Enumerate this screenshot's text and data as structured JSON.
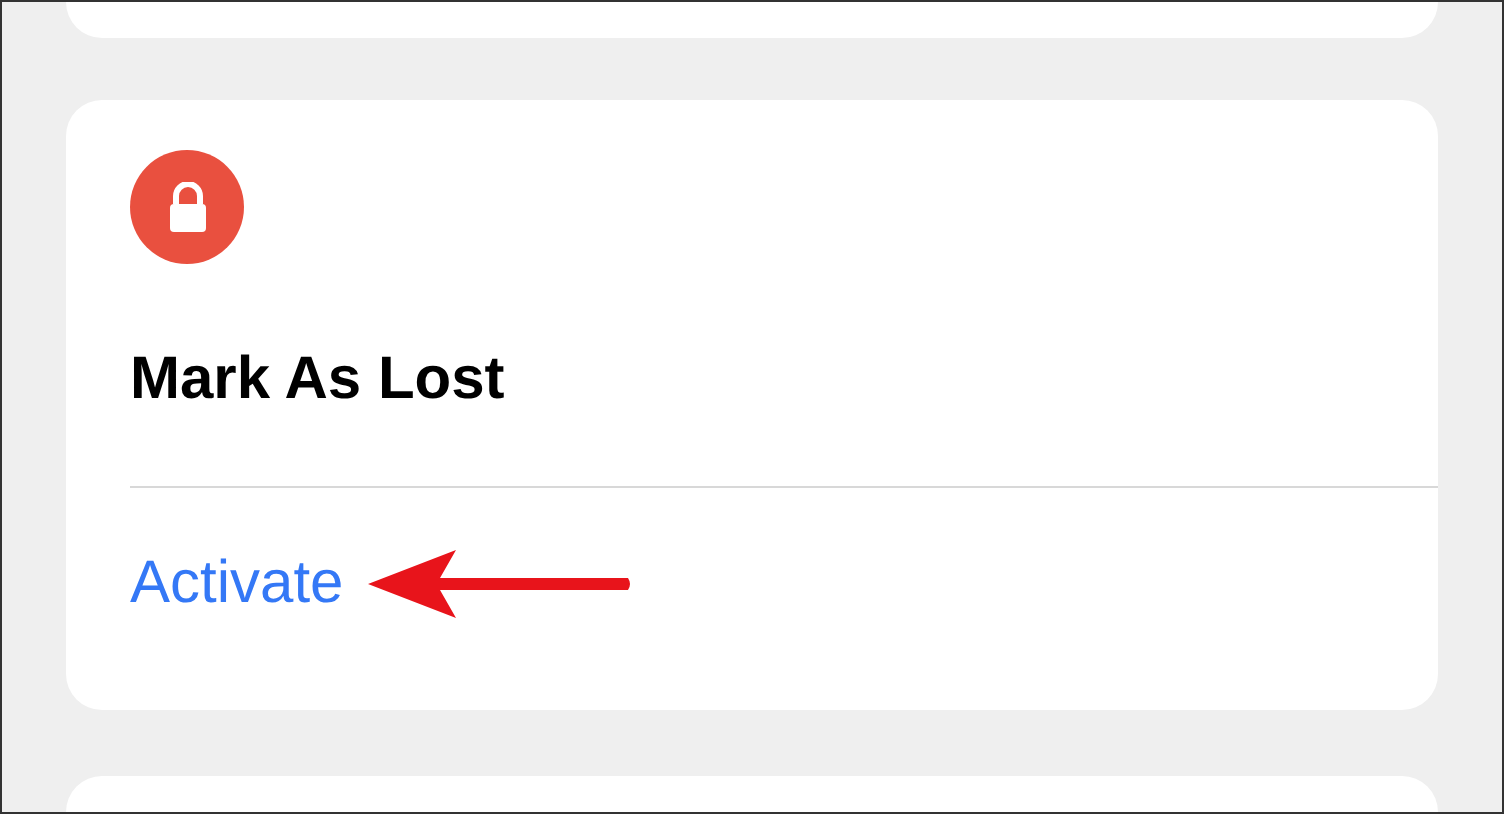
{
  "card": {
    "title": "Mark As Lost",
    "action": "Activate"
  }
}
